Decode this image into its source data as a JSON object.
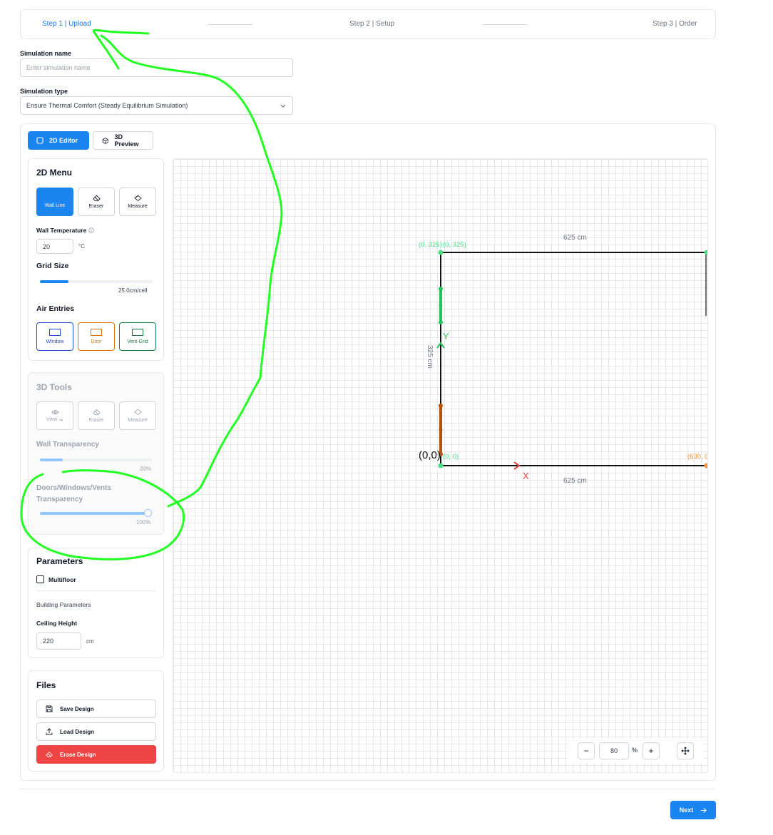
{
  "stepper": {
    "step1": "Step 1 | Upload",
    "step2": "Step 2 | Setup",
    "step3": "Step 3 | Order"
  },
  "simulation_name": {
    "label": "Simulation name",
    "placeholder": "Enter simulation name",
    "value": ""
  },
  "simulation_type": {
    "label": "Simulation type",
    "selected": "Ensure Thermal Comfort (Steady Equilibrium Simulation)"
  },
  "tabs": [
    {
      "label": "2D Editor",
      "active": true,
      "icon": "square-icon"
    },
    {
      "label": "3D Preview",
      "active": false,
      "icon": "cube-icon"
    }
  ],
  "menu2d": {
    "title": "2D Menu",
    "tools": [
      {
        "label": "Wall Line",
        "icon": "wall-line-icon",
        "active": true
      },
      {
        "label": "Eraser",
        "icon": "eraser-icon",
        "active": false
      },
      {
        "label": "Measure",
        "icon": "ruler-icon",
        "active": false
      }
    ],
    "wall_temperature_label": "Wall Temperature",
    "wall_temperature_value": "20",
    "wall_temperature_unit": "°C",
    "grid_size_label": "Grid Size",
    "grid_size_value_text": "25.0cm/cell",
    "grid_size_fraction": 0.25,
    "air_entries_label": "Air Entries",
    "air_entries": [
      {
        "label": "Window",
        "color": "#1d4ed8"
      },
      {
        "label": "Door",
        "color": "#d97706"
      },
      {
        "label": "Vent-Grid",
        "color": "#15803d"
      }
    ]
  },
  "tools3d": {
    "title": "3D Tools",
    "tools": [
      {
        "label": "View",
        "icon": "eye-icon"
      },
      {
        "label": "Eraser",
        "icon": "eraser-icon"
      },
      {
        "label": "Measure",
        "icon": "ruler-icon"
      }
    ],
    "wall_transparency_label": "Wall Transparency",
    "wall_transparency_text": "20%",
    "wall_transparency_fraction": 0.2,
    "dwv_transparency_label": "Doors/Windows/Vents Transparency",
    "dwv_transparency_text": "100%",
    "dwv_transparency_fraction": 1.0
  },
  "parameters": {
    "title": "Parameters",
    "multifloor_label": "Multifloor",
    "multifloor_checked": false,
    "building_parameters_label": "Building Parameters",
    "ceiling_height_label": "Ceiling Height",
    "ceiling_height_value": "220",
    "ceiling_height_unit": "cm"
  },
  "files": {
    "title": "Files",
    "save_label": "Save Design",
    "load_label": "Load Design",
    "erase_label": "Erase Design"
  },
  "canvas_labels": {
    "top_width": "625 cm",
    "bottom_width": "625 cm",
    "height": "325 cm",
    "corner_tl_1": "(0, 325)",
    "corner_tl_2": "(0, 325)",
    "origin_big": "(0,0)",
    "origin_small": "(0, 0)",
    "corner_br": "(630, 0",
    "axis_x": "X",
    "axis_y": "Y"
  },
  "zoom": {
    "value": "80",
    "unit": "%",
    "minus": "−",
    "plus": "+"
  },
  "footer": {
    "next_label": "Next"
  },
  "colors": {
    "accent": "#1a84f0",
    "danger": "#ef4444",
    "annotation": "#22ff22",
    "wall": "#111111",
    "coord_green": "#4ade80",
    "coord_orange": "#fb923c"
  }
}
